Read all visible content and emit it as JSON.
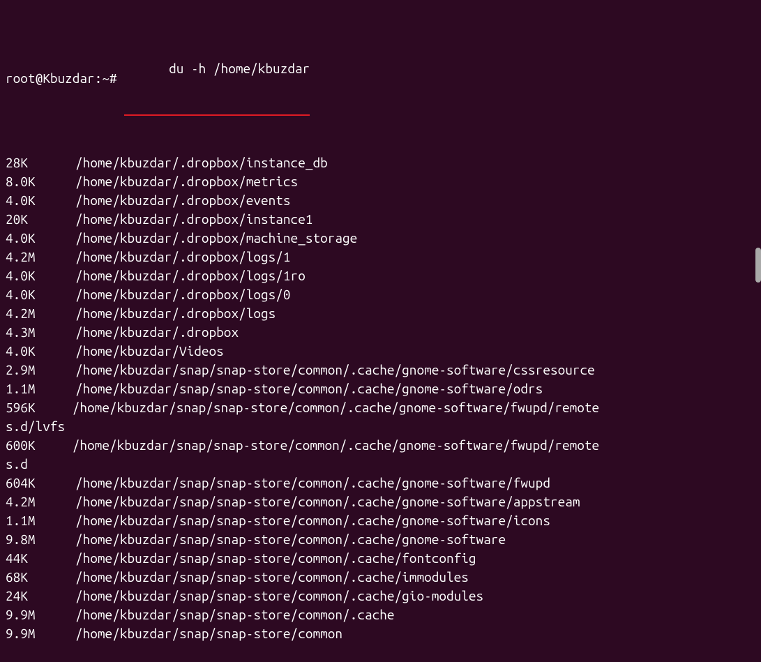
{
  "prompt": "root@Kbuzdar:~# ",
  "command": "du -h /home/kbuzdar",
  "output": [
    {
      "size": "28K",
      "path": "/home/kbuzdar/.dropbox/instance_db"
    },
    {
      "size": "8.0K",
      "path": "/home/kbuzdar/.dropbox/metrics"
    },
    {
      "size": "4.0K",
      "path": "/home/kbuzdar/.dropbox/events"
    },
    {
      "size": "20K",
      "path": "/home/kbuzdar/.dropbox/instance1"
    },
    {
      "size": "4.0K",
      "path": "/home/kbuzdar/.dropbox/machine_storage"
    },
    {
      "size": "4.2M",
      "path": "/home/kbuzdar/.dropbox/logs/1"
    },
    {
      "size": "4.0K",
      "path": "/home/kbuzdar/.dropbox/logs/1ro"
    },
    {
      "size": "4.0K",
      "path": "/home/kbuzdar/.dropbox/logs/0"
    },
    {
      "size": "4.2M",
      "path": "/home/kbuzdar/.dropbox/logs"
    },
    {
      "size": "4.3M",
      "path": "/home/kbuzdar/.dropbox"
    },
    {
      "size": "4.0K",
      "path": "/home/kbuzdar/Videos"
    },
    {
      "size": "2.9M",
      "path": "/home/kbuzdar/snap/snap-store/common/.cache/gnome-software/cssresource"
    },
    {
      "size": "1.1M",
      "path": "/home/kbuzdar/snap/snap-store/common/.cache/gnome-software/odrs"
    },
    {
      "size": "596K",
      "path": "/home/kbuzdar/snap/snap-store/common/.cache/gnome-software/fwupd/remotes.d/lvfs",
      "wrap": true
    },
    {
      "size": "600K",
      "path": "/home/kbuzdar/snap/snap-store/common/.cache/gnome-software/fwupd/remotes.d",
      "wrap": true
    },
    {
      "size": "604K",
      "path": "/home/kbuzdar/snap/snap-store/common/.cache/gnome-software/fwupd"
    },
    {
      "size": "4.2M",
      "path": "/home/kbuzdar/snap/snap-store/common/.cache/gnome-software/appstream"
    },
    {
      "size": "1.1M",
      "path": "/home/kbuzdar/snap/snap-store/common/.cache/gnome-software/icons"
    },
    {
      "size": "9.8M",
      "path": "/home/kbuzdar/snap/snap-store/common/.cache/gnome-software"
    },
    {
      "size": "44K",
      "path": "/home/kbuzdar/snap/snap-store/common/.cache/fontconfig"
    },
    {
      "size": "68K",
      "path": "/home/kbuzdar/snap/snap-store/common/.cache/immodules"
    },
    {
      "size": "24K",
      "path": "/home/kbuzdar/snap/snap-store/common/.cache/gio-modules"
    },
    {
      "size": "9.9M",
      "path": "/home/kbuzdar/snap/snap-store/common/.cache"
    },
    {
      "size": "9.9M",
      "path": "/home/kbuzdar/snap/snap-store/common"
    }
  ]
}
